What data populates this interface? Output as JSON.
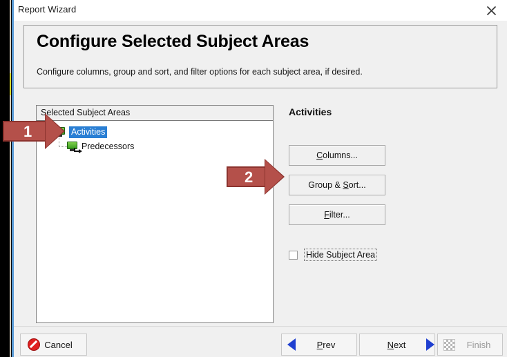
{
  "window": {
    "title": "Report Wizard",
    "close_icon": "close-icon"
  },
  "header": {
    "title": "Configure Selected Subject Areas",
    "subtitle": "Configure columns, group and sort, and filter options for each subject area, if desired."
  },
  "tree": {
    "header_label": "Selected Subject Areas",
    "nodes": [
      {
        "label": "Activities",
        "icon": "subject-area-icon",
        "selected": true
      },
      {
        "label": "Predecessors",
        "icon": "subject-area-link-icon",
        "selected": false
      }
    ]
  },
  "side_panel": {
    "title": "Activities",
    "buttons": [
      {
        "label_pre": "",
        "mnemonic": "C",
        "label_post": "olumns...",
        "name": "columns-button"
      },
      {
        "label_pre": "Group & ",
        "mnemonic": "S",
        "label_post": "ort...",
        "name": "group-sort-button"
      },
      {
        "label_pre": "",
        "mnemonic": "F",
        "label_post": "ilter...",
        "name": "filter-button"
      }
    ],
    "checkbox": {
      "label": "Hide Subject Area",
      "checked": false
    }
  },
  "footer": {
    "cancel": {
      "label": "Cancel",
      "icon": "cancel-icon"
    },
    "prev": {
      "label_pre": "",
      "mnemonic": "P",
      "label_post": "rev",
      "icon": "triangle-left-icon"
    },
    "next": {
      "label_pre": "",
      "mnemonic": "N",
      "label_post": "ext",
      "icon": "triangle-right-icon"
    },
    "finish": {
      "label": "Finish",
      "icon": "finish-checker-icon",
      "disabled": true
    }
  },
  "annotations": [
    {
      "number": "1",
      "target": "activities-tree-node",
      "color": "#b4504a"
    },
    {
      "number": "2",
      "target": "group-sort-button",
      "color": "#b4504a"
    }
  ],
  "colors": {
    "accent_blue": "#2a7fd4",
    "annotation_red": "#b4504a",
    "annotation_red_dark": "#8c332e",
    "edge_blue": "#5b9bd5",
    "edge_yellow": "#d8d82a",
    "node_green": "#3a9c1f",
    "cancel_red": "#e02020",
    "nav_blue": "#1f3fd0"
  }
}
